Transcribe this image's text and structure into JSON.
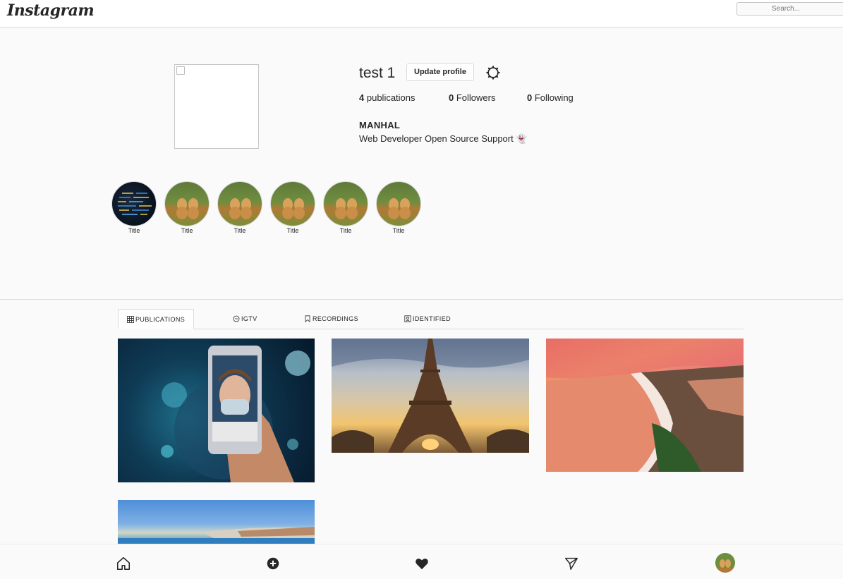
{
  "header": {
    "logo_text": "Instagram",
    "search_placeholder": "Search..."
  },
  "profile": {
    "username": "test 1",
    "update_button": "Update profile",
    "stats": {
      "publications_count": "4",
      "publications_label": "publications",
      "followers_count": "0",
      "followers_label": "Followers",
      "following_count": "0",
      "following_label": "Following"
    },
    "full_name": "MANHAL",
    "bio": "Web Developer Open Source Support 👻"
  },
  "highlights": [
    {
      "title": "Title",
      "image": "code"
    },
    {
      "title": "Title",
      "image": "dogs"
    },
    {
      "title": "Title",
      "image": "dogs"
    },
    {
      "title": "Title",
      "image": "dogs"
    },
    {
      "title": "Title",
      "image": "dogs"
    },
    {
      "title": "Title",
      "image": "dogs"
    }
  ],
  "tabs": [
    {
      "label": "PUBLICATIONS",
      "icon": "grid-icon",
      "active": true
    },
    {
      "label": "IGTV",
      "icon": "igtv-icon",
      "active": false
    },
    {
      "label": "RECORDINGS",
      "icon": "bookmark-icon",
      "active": false
    },
    {
      "label": "IDENTIFIED",
      "icon": "tagged-icon",
      "active": false
    }
  ],
  "posts": [
    {
      "subject": "covid-phone-mask"
    },
    {
      "subject": "eiffel-tower"
    },
    {
      "subject": "nice-coastline-sunset"
    },
    {
      "subject": "coastline-blue-sky"
    }
  ],
  "bottom_nav": [
    "home-icon",
    "add-icon",
    "heart-icon",
    "direct-icon",
    "profile-avatar"
  ],
  "colors": {
    "background": "#fafafa",
    "border": "#dbdbdb",
    "text": "#262626",
    "muted": "#8e8e8e"
  }
}
